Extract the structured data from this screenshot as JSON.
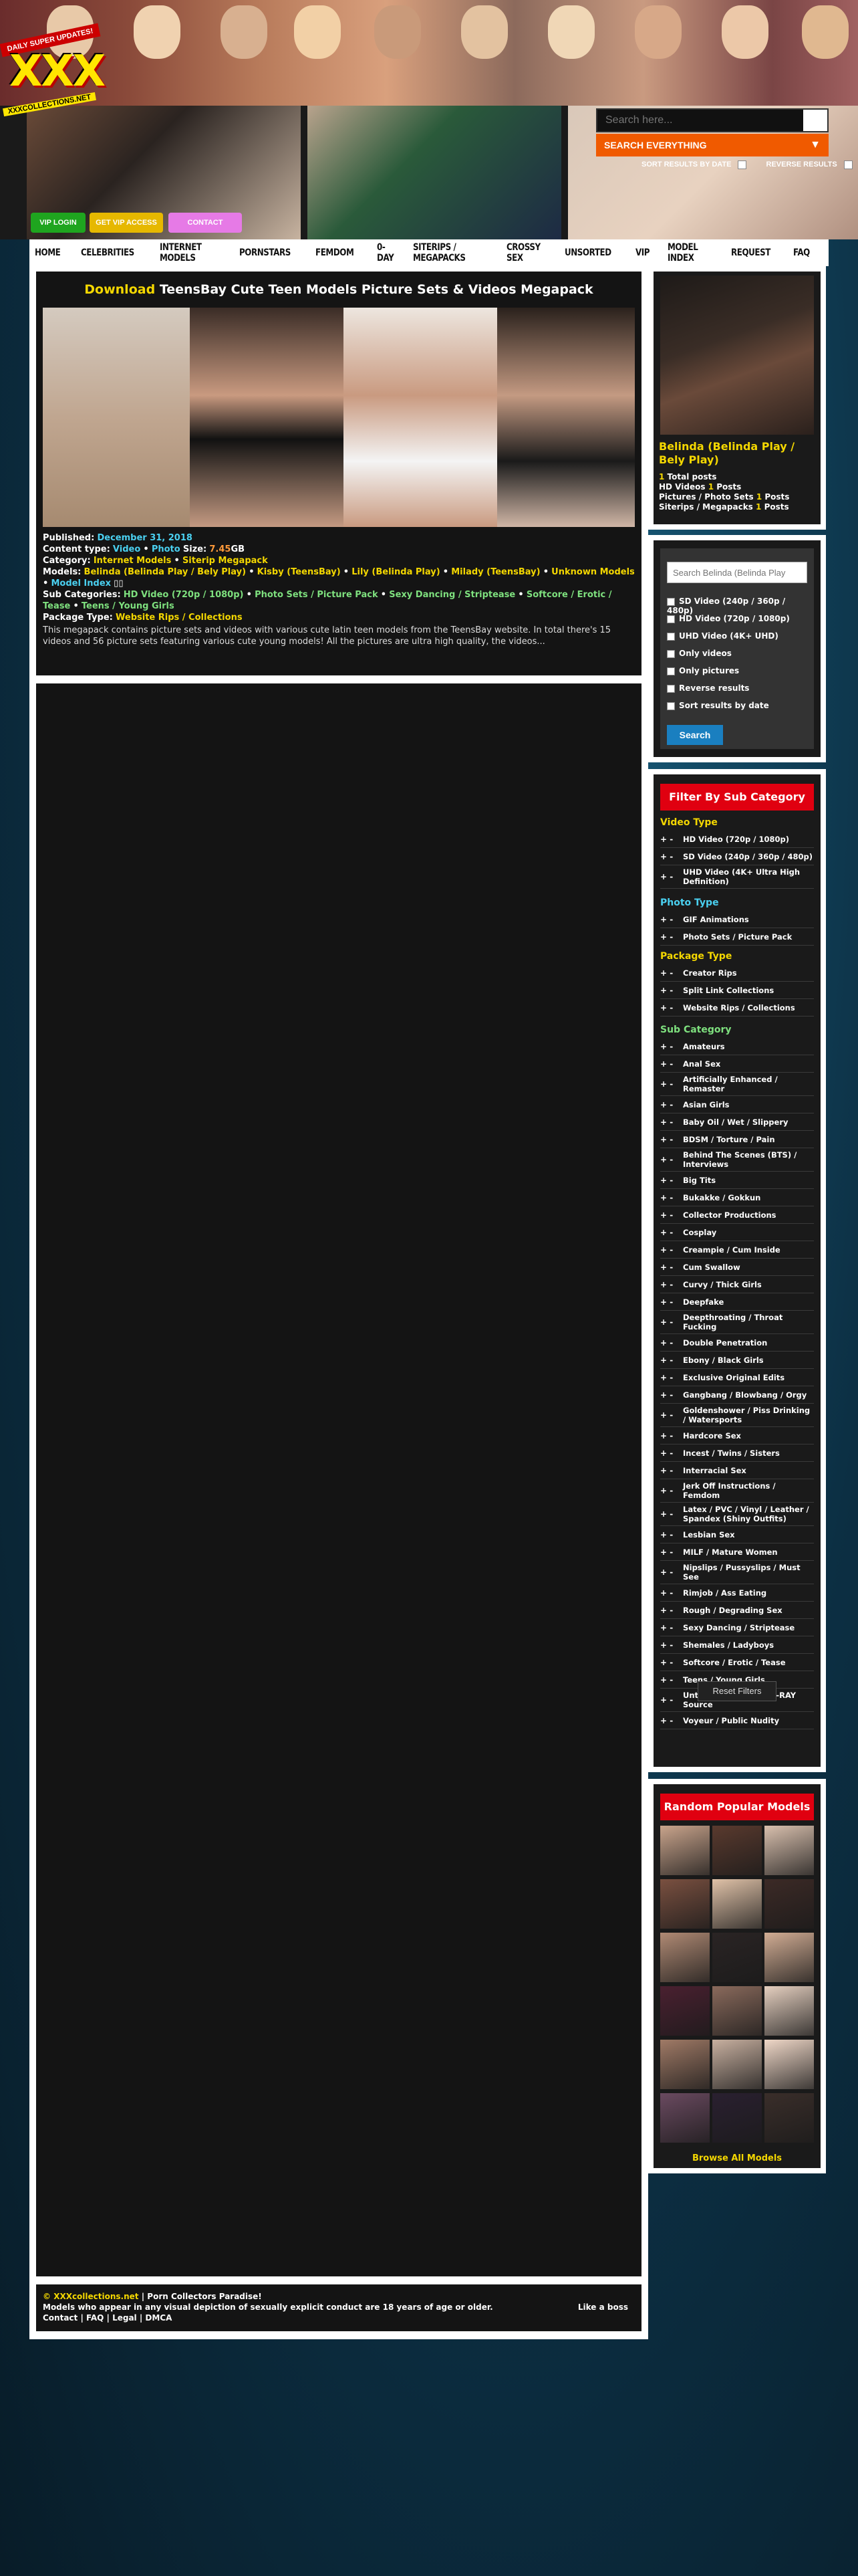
{
  "header": {
    "logo_ribbon": "DAILY SUPER UPDATES!",
    "logo_text": "XXX",
    "logo_site": "XXXCOLLECTIONS.NET",
    "search_placeholder": "Search here...",
    "search_scope": "SEARCH EVERYTHING",
    "sort_by_date": "SORT RESULTS BY DATE",
    "reverse_results": "REVERSE RESULTS",
    "vip_login": "VIP LOGIN",
    "get_vip": "GET VIP ACCESS",
    "contact": "CONTACT"
  },
  "nav": [
    "HOME",
    "CELEBRITIES",
    "INTERNET MODELS",
    "PORNSTARS",
    "FEMDOM",
    "0-DAY",
    "SITERIPS / MEGAPACKS",
    "CROSSY SEX",
    "UNSORTED",
    "VIP",
    "MODEL INDEX",
    "REQUEST",
    "FAQ"
  ],
  "post": {
    "title_prefix": "Download",
    "title": "TeensBay Cute Teen Models Picture Sets & Videos Megapack",
    "published_label": "Published:",
    "published": "December 31, 2018",
    "content_type_label": "Content type:",
    "content_video": "Video",
    "content_photo": "Photo",
    "size_label": "Size:",
    "size": "7.45",
    "size_unit": "GB",
    "category_label": "Category:",
    "category_1": "Internet Models",
    "category_2": "Siterip Megapack",
    "models_label": "Models:",
    "model_1": "Belinda (Belinda Play / Bely Play)",
    "model_2": "Kisby (TeensBay)",
    "model_3": "Lily (Belinda Play)",
    "model_4": "Milady (TeensBay)",
    "model_5": "Unknown Models",
    "model_index": "Model Index",
    "subcat_label": "Sub Categories:",
    "subcat_1": "HD Video (720p / 1080p)",
    "subcat_2": "Photo Sets / Picture Pack",
    "subcat_3": "Sexy Dancing / Striptease",
    "subcat_4": "Softcore / Erotic / Tease",
    "subcat_5": "Teens / Young Girls",
    "package_label": "Package Type:",
    "package": "Website Rips / Collections",
    "description": "This megapack contains picture sets and videos with various cute latin teen models from the TeensBay website. In total there's 15 videos and 56 picture sets featuring various cute young models! All the pictures are ultra high quality, the videos..."
  },
  "footer": {
    "copyright_prefix": "©",
    "site": "XXXcollections.net",
    "tagline": "| Porn Collectors Paradise!",
    "disclaimer": "Models who appear in any visual depiction of sexually explicit conduct are 18 years of age or older.",
    "links": "Contact | FAQ | Legal | DMCA",
    "like": "Like a boss"
  },
  "sidebar": {
    "model_name": "Belinda (Belinda Play / Bely Play)",
    "total_count": "1",
    "total_label": "Total posts",
    "hd_label": "HD Videos",
    "hd_count": "1",
    "hd_suffix": "Posts",
    "pics_label": "Pictures / Photo Sets",
    "pics_count": "1",
    "pics_suffix": "Posts",
    "siterips_label": "Siterips / Megapacks",
    "siterips_count": "1",
    "siterips_suffix": "Posts",
    "search_placeholder": "Search Belinda (Belinda Play",
    "search_options": [
      "SD Video (240p / 360p / 480p)",
      "HD Video (720p / 1080p)",
      "UHD Video (4K+ UHD)",
      "Only videos",
      "Only pictures",
      "Reverse results",
      "Sort results by date"
    ],
    "search_button": "Search",
    "filter_title": "Filter By Sub Category",
    "video_type": "Video Type",
    "video_items": [
      "HD Video (720p / 1080p)",
      "SD Video (240p / 360p / 480p)",
      "UHD Video (4K+ Ultra High Definition)"
    ],
    "photo_type": "Photo Type",
    "photo_items": [
      "GIF Animations",
      "Photo Sets / Picture Pack"
    ],
    "package_type": "Package Type",
    "package_items": [
      "Creator Rips",
      "Split Link Collections",
      "Website Rips / Collections"
    ],
    "sub_category": "Sub Category",
    "sub_items": [
      "Amateurs",
      "Anal Sex",
      "Artificially Enhanced / Remaster",
      "Asian Girls",
      "Baby Oil / Wet / Slippery",
      "BDSM / Torture / Pain",
      "Behind The Scenes (BTS) / Interviews",
      "Big Tits",
      "Bukakke / Gokkun",
      "Collector Productions",
      "Cosplay",
      "Creampie / Cum Inside",
      "Cum Swallow",
      "Curvy / Thick Girls",
      "Deepfake",
      "Deepthroating / Throat Fucking",
      "Double Penetration",
      "Ebony / Black Girls",
      "Exclusive Original Edits",
      "Gangbang / Blowbang / Orgy",
      "Goldenshower / Piss Drinking / Watersports",
      "Hardcore Sex",
      "Incest / Twins / Sisters",
      "Interracial Sex",
      "Jerk Off Instructions / Femdom",
      "Latex / PVC / Vinyl / Leather / Spandex (Shiny Outfits)",
      "Lesbian Sex",
      "MILF / Mature Women",
      "Nipslips / Pussyslips / Must See",
      "Rimjob / Ass Eating",
      "Rough / Degrading Sex",
      "Sexy Dancing / Striptease",
      "Shemales / Ladyboys",
      "Softcore / Erotic / Tease",
      "Teens / Young Girls",
      "Untouched DVD / BLU-RAY Source",
      "Voyeur / Public Nudity"
    ],
    "reset_filters": "Reset Filters",
    "popular_title": "Random Popular Models",
    "browse_all": "Browse All Models",
    "plus_minus": "+ -"
  },
  "colors": {
    "accent_yellow": "#f4d700",
    "accent_cyan": "#4ad0f0",
    "accent_green": "#7ee07e",
    "accent_orange": "#f05a00",
    "filter_red": "#e00010",
    "search_blue": "#1a7fc0"
  }
}
